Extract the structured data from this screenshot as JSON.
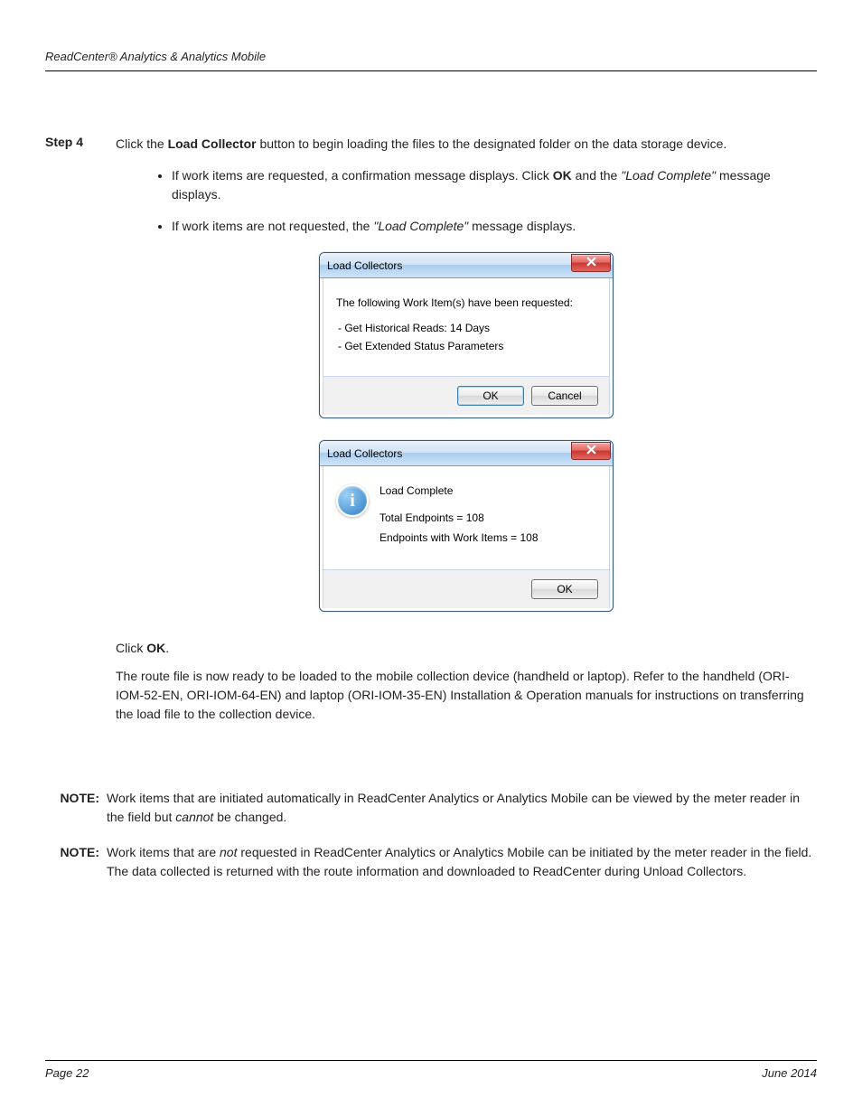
{
  "header": {
    "title": "ReadCenter® Analytics & Analytics Mobile"
  },
  "step": {
    "label": "Step 4",
    "intro_pre": "Click the ",
    "intro_bold": "Load Collector",
    "intro_post": " button to begin loading the files to the designated folder on the data storage device.",
    "bullet1_pre": "If work items are requested, a confirmation message displays. Click ",
    "bullet1_bold": "OK",
    "bullet1_mid": " and the ",
    "bullet1_italic": "\"Load Complete\"",
    "bullet1_post": " message displays.",
    "bullet2_pre": "If work items are not requested, the ",
    "bullet2_italic": "\"Load Complete\"",
    "bullet2_post": " message displays."
  },
  "dialog1": {
    "title": "Load Collectors",
    "message": "The following Work Item(s) have been requested:",
    "item1": "- Get Historical Reads: 14 Days",
    "item2": "- Get Extended Status Parameters",
    "ok": "OK",
    "cancel": "Cancel"
  },
  "dialog2": {
    "title": "Load Collectors",
    "line1": "Load Complete",
    "line2": "Total Endpoints = 108",
    "line3": "Endpoints with Work Items = 108",
    "ok": "OK"
  },
  "after": {
    "click_pre": "Click ",
    "click_bold": "OK",
    "click_post": ".",
    "para": "The route file is now ready to be loaded to the mobile collection device (handheld or laptop). Refer to the handheld (ORI-IOM-52-EN, ORI-IOM-64-EN) and laptop (ORI-IOM-35-EN) Installation & Operation manuals for instructions on transferring the load file to the collection device."
  },
  "note1": {
    "label": "NOTE:",
    "pre": "Work items that are initiated automatically in ReadCenter Analytics or Analytics Mobile can be viewed by the meter reader in the field but ",
    "italic": "cannot",
    "post": " be changed."
  },
  "note2": {
    "label": "NOTE:",
    "pre": "Work items that are ",
    "italic": "not",
    "post": " requested in ReadCenter Analytics or Analytics Mobile can be initiated by the meter reader in the field. The data collected is returned with the route information and downloaded to ReadCenter during Unload Collectors."
  },
  "footer": {
    "page": "Page 22",
    "date": "June 2014"
  }
}
